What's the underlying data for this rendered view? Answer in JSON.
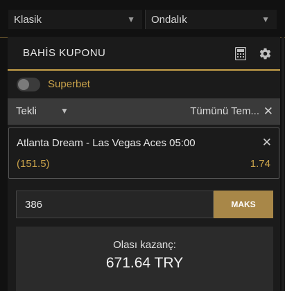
{
  "top_selects": {
    "format": {
      "value": "Klasik"
    },
    "odds_format": {
      "value": "Ondalık"
    }
  },
  "header": {
    "title": "BAHİS KUPONU",
    "icons": [
      "calculator-icon",
      "gear-icon"
    ]
  },
  "superbet": {
    "label": "Superbet",
    "enabled": false
  },
  "bet_type": {
    "selected": "Tekli",
    "clear_all_label": "Tümünü Tem..."
  },
  "selection": {
    "match": "Atlanta Dream - Las Vegas Aces 05:00",
    "line": "(151.5)",
    "odd": "1.74"
  },
  "stake": {
    "value": "386",
    "max_label": "MAKS"
  },
  "potential_win": {
    "label": "Olası kazanç:",
    "amount": "671.64 TRY"
  },
  "colors": {
    "accent": "#c9a24a",
    "max_button": "#a88748",
    "background": "#1b1b1b"
  }
}
